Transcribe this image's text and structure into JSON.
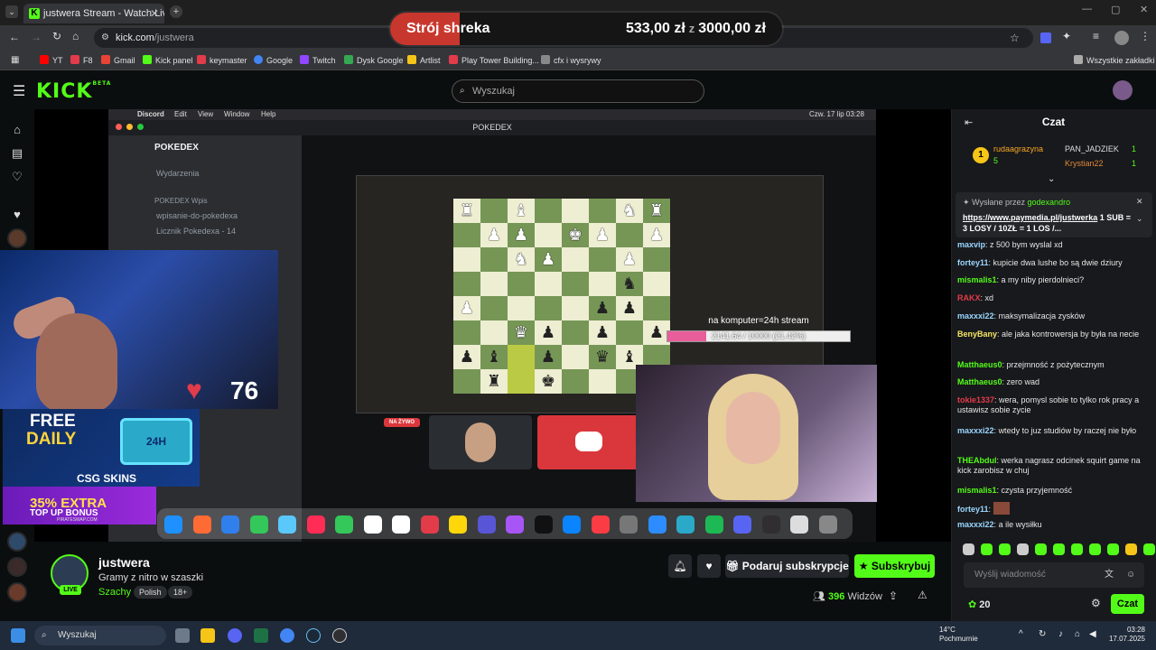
{
  "browser": {
    "tab_title": "justwera Stream - Watch Live o",
    "url_host": "kick.com",
    "url_path": "/justwera",
    "bookmarks": [
      "YT",
      "F8",
      "Gmail",
      "Kick panel",
      "keymaster",
      "Google",
      "Twitch",
      "Dysk Google",
      "Artlist",
      "Play Tower Building...",
      "cfx i wysrywy"
    ],
    "all_bookmarks": "Wszystkie zakładki"
  },
  "donation": {
    "label": "Strój shreka",
    "current": "533,00 zł",
    "separator": "z",
    "target": "3000,00 zł",
    "progress": 0.1777
  },
  "kick": {
    "logo": "KICK",
    "beta": "BETA",
    "search_placeholder": "Wyszukaj"
  },
  "stream_overlay": {
    "mac_menu": [
      "Discord",
      "Edit",
      "View",
      "Window",
      "Help"
    ],
    "mac_clock": "Czw. 17 lip  03:28",
    "discord_server": "POKEDEX",
    "discord_channels": [
      "Wydarzenia",
      "POKEDEX Wpis",
      "wpisanie-do-pokedexa",
      "Licznik Pokedexa - 14"
    ],
    "live_label": "NA ŻYWO",
    "goal_text": "na komputer=24h stream",
    "goal_value": "2141.64 / 10000 (21.42%)",
    "goal_progress": 0.2142,
    "heart_rate": "76",
    "ad1_line1": "FREE",
    "ad1_line2": "DAILY",
    "ad1_chest": "24H",
    "ad1_brand": "CSG SKINS",
    "ad2_line1": "35% EXTRA",
    "ad2_line2": "TOP UP BONUS",
    "ad2_brand": "PIRATESWAP.COM"
  },
  "stream": {
    "streamer": "justwera",
    "live_badge": "LIVE",
    "title": "Gramy z nitro w szaszki",
    "category": "Szachy",
    "tags": [
      "Polish",
      "18+"
    ],
    "gift_button": "Podaruj subskrypcje",
    "subscribe_button": "Subskrybuj",
    "viewers": "396",
    "viewers_label": "Widzów"
  },
  "chat": {
    "title": "Czat",
    "leaders": [
      {
        "name": "rudaagrazyna",
        "count": "5",
        "color": "#f5a623"
      },
      {
        "name": "PAN_JADZIEK",
        "count": "1",
        "color": "#cccccc"
      },
      {
        "name": "Krystian22",
        "count": "1",
        "color": "#e0883a"
      }
    ],
    "pinned_by": "Wysłane przez",
    "pinned_user": "godexandro",
    "pinned_link": "https://www.paymedia.pl/justwerka",
    "pinned_text": "1 SUB = 3 LOSY / 10ZŁ = 1 LOS /...",
    "messages": [
      {
        "user": "maxvip",
        "color": "#9ad6ff",
        "text": "z 500 bym wyslal xd"
      },
      {
        "user": "fortey11",
        "color": "#9ad6ff",
        "text": "kupicie dwa lushe bo są dwie dziury"
      },
      {
        "user": "mismalis1",
        "color": "#53fc18",
        "text": "a my niby pierdolnieci?"
      },
      {
        "user": "RAKX",
        "color": "#e23b4a",
        "text": "xd"
      },
      {
        "user": "maxxxi22",
        "color": "#9ad6ff",
        "text": "maksymalizacja zysków"
      },
      {
        "user": "BenyBany",
        "color": "#f5e663",
        "text": "ale jaka kontrowersja by była na necie"
      },
      {
        "user": "Matthaeus0",
        "color": "#53fc18",
        "text": "przejmność z pożytecznym"
      },
      {
        "user": "Matthaeus0",
        "color": "#53fc18",
        "text": "zero wad"
      },
      {
        "user": "tokie1337",
        "color": "#e23b4a",
        "text": "wera, pomysl sobie to tylko rok pracy a ustawisz sobie zycie"
      },
      {
        "user": "maxxxi22",
        "color": "#9ad6ff",
        "text": "wtedy to juz studiów by raczej nie było"
      },
      {
        "user": "THEAbdul",
        "color": "#53fc18",
        "text": "werka nagrasz odcinek squirt game na kick zarobisz w chuj"
      },
      {
        "user": "mismalis1",
        "color": "#53fc18",
        "text": "czysta przyjemność"
      },
      {
        "user": "fortey11",
        "color": "#9ad6ff",
        "text": ""
      },
      {
        "user": "maxxxi22",
        "color": "#9ad6ff",
        "text": "a ile wysiłku"
      }
    ],
    "input_placeholder": "Wyślij wiadomość",
    "points": "20",
    "send_button": "Czat"
  },
  "taskbar": {
    "search": "Wyszukaj",
    "weather_temp": "14°C",
    "weather_desc": "Pochmurnie",
    "time": "03:28",
    "date": "17.07.2025"
  },
  "colors": {
    "kick_green": "#53fc18",
    "bg": "#0b0e0f",
    "chat_bg": "#18191c"
  }
}
